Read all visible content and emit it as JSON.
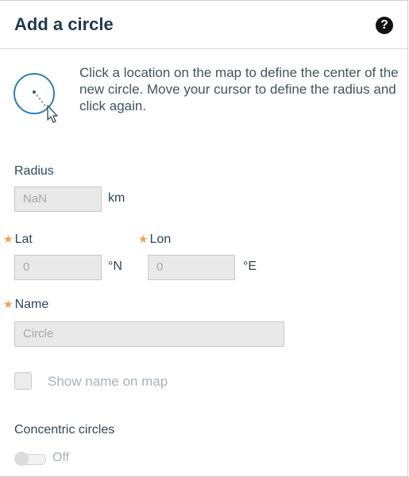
{
  "header": {
    "title": "Add a circle",
    "help_icon": "question-circle-icon"
  },
  "intro": {
    "icon": "circle-tool-icon",
    "text": "Click a location on the map to define the center of the new circle. Move your cursor to define the radius and click again."
  },
  "form": {
    "radius": {
      "label": "Radius",
      "value": "NaN",
      "unit": "km"
    },
    "lat": {
      "label": "Lat",
      "value": "0",
      "unit": "°N",
      "required": true
    },
    "lon": {
      "label": "Lon",
      "value": "0",
      "unit": "°E",
      "required": true
    },
    "name": {
      "label": "Name",
      "placeholder": "Circle",
      "required": true
    },
    "show_name": {
      "label": "Show name on map",
      "checked": false
    },
    "concentric": {
      "label": "Concentric circles",
      "toggle_state": "Off"
    }
  },
  "colors": {
    "accent": "#2b7fb8",
    "required_star": "#f0a04b",
    "disabled_bg": "#e9e9e9",
    "text": "#2f4858"
  }
}
